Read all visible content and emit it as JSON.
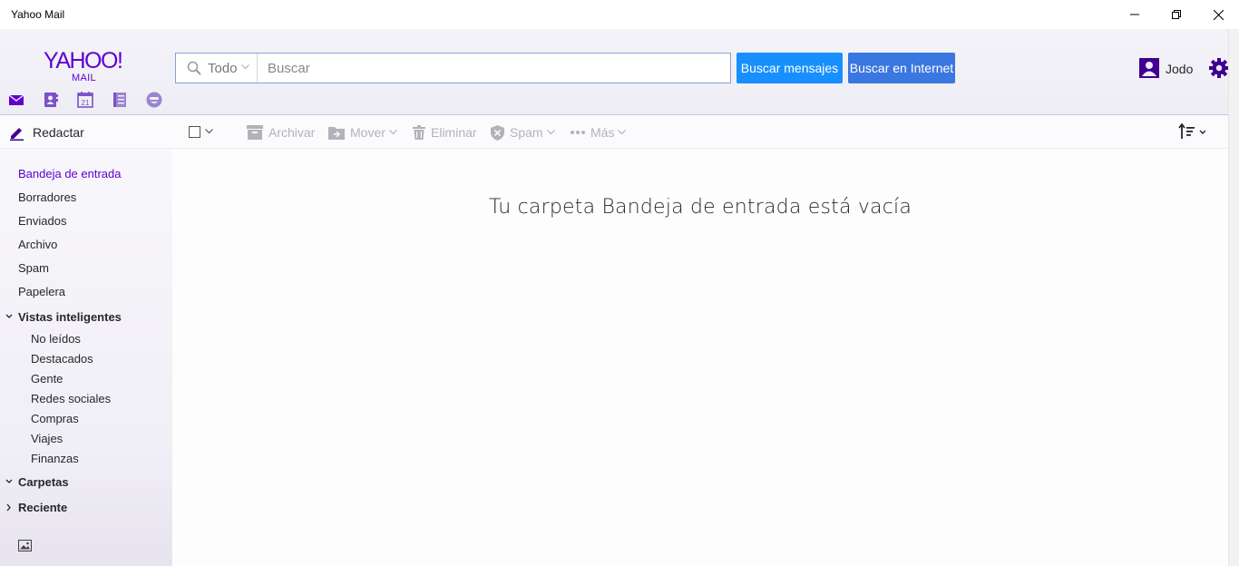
{
  "window": {
    "title": "Yahoo Mail",
    "controls": [
      "minimize-icon",
      "maximize-icon",
      "close-icon"
    ]
  },
  "brand": {
    "logo_text": "YAHOO!",
    "logo_sub": "MAIL",
    "accent_color": "#6001d2"
  },
  "apps": [
    "mail-icon",
    "contacts-icon",
    "calendar-icon",
    "notepad-icon",
    "messenger-icon"
  ],
  "calendar_day": "21",
  "search": {
    "scope_label": "Todo",
    "placeholder": "Buscar",
    "value": "",
    "search_messages_label": "Buscar mensajes",
    "search_web_label": "Buscar en Internet"
  },
  "user": {
    "name": "Jodo"
  },
  "toolbar": {
    "compose_label": "Redactar",
    "archive_label": "Archivar",
    "move_label": "Mover",
    "delete_label": "Eliminar",
    "spam_label": "Spam",
    "more_label": "Más"
  },
  "sidebar": {
    "folders": [
      "Bandeja de entrada",
      "Borradores",
      "Enviados",
      "Archivo",
      "Spam",
      "Papelera"
    ],
    "smart_views_title": "Vistas inteligentes",
    "smart_views": [
      "No leídos",
      "Destacados",
      "Gente",
      "Redes sociales",
      "Compras",
      "Viajes",
      "Finanzas"
    ],
    "folders_title": "Carpetas",
    "recent_title": "Reciente"
  },
  "main": {
    "empty_message": "Tu carpeta Bandeja de entrada está vacía"
  }
}
